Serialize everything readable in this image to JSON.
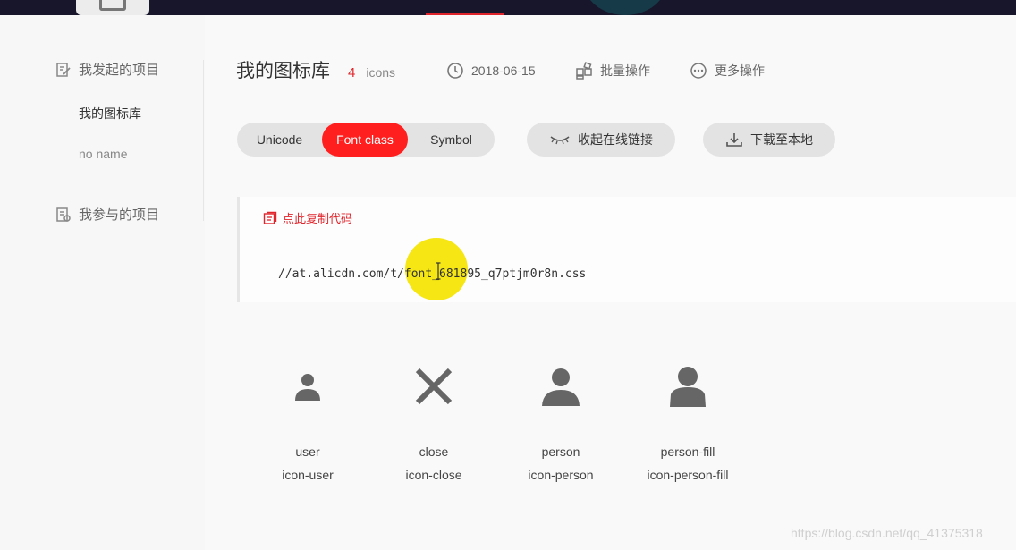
{
  "sidebar": {
    "group_created": "我发起的项目",
    "items": [
      {
        "label": "我的图标库"
      },
      {
        "label": "no name"
      }
    ],
    "group_joined": "我参与的项目"
  },
  "header": {
    "title": "我的图标库",
    "count": "4",
    "count_unit": "icons",
    "date": "2018-06-15",
    "batch_label": "批量操作",
    "more_label": "更多操作"
  },
  "tabs": [
    {
      "label": "Unicode",
      "active": false
    },
    {
      "label": "Font class",
      "active": true
    },
    {
      "label": "Symbol",
      "active": false
    }
  ],
  "actions": {
    "collapse_link_label": "收起在线链接",
    "download_label": "下载至本地"
  },
  "code": {
    "copy_label": "点此复制代码",
    "url": "//at.alicdn.com/t/font_681895_q7ptjm0r8n.css"
  },
  "icons": [
    {
      "name": "user",
      "class": "icon-user",
      "glyph": "user-icon"
    },
    {
      "name": "close",
      "class": "icon-close",
      "glyph": "close-icon"
    },
    {
      "name": "person",
      "class": "icon-person",
      "glyph": "person-icon"
    },
    {
      "name": "person-fill",
      "class": "icon-person-fill",
      "glyph": "person-fill-icon"
    }
  ],
  "watermark": "https://blog.csdn.net/qq_41375318",
  "colors": {
    "accent": "#ff1f1f",
    "topbar": "#17162b",
    "icon_gray": "#666666"
  }
}
